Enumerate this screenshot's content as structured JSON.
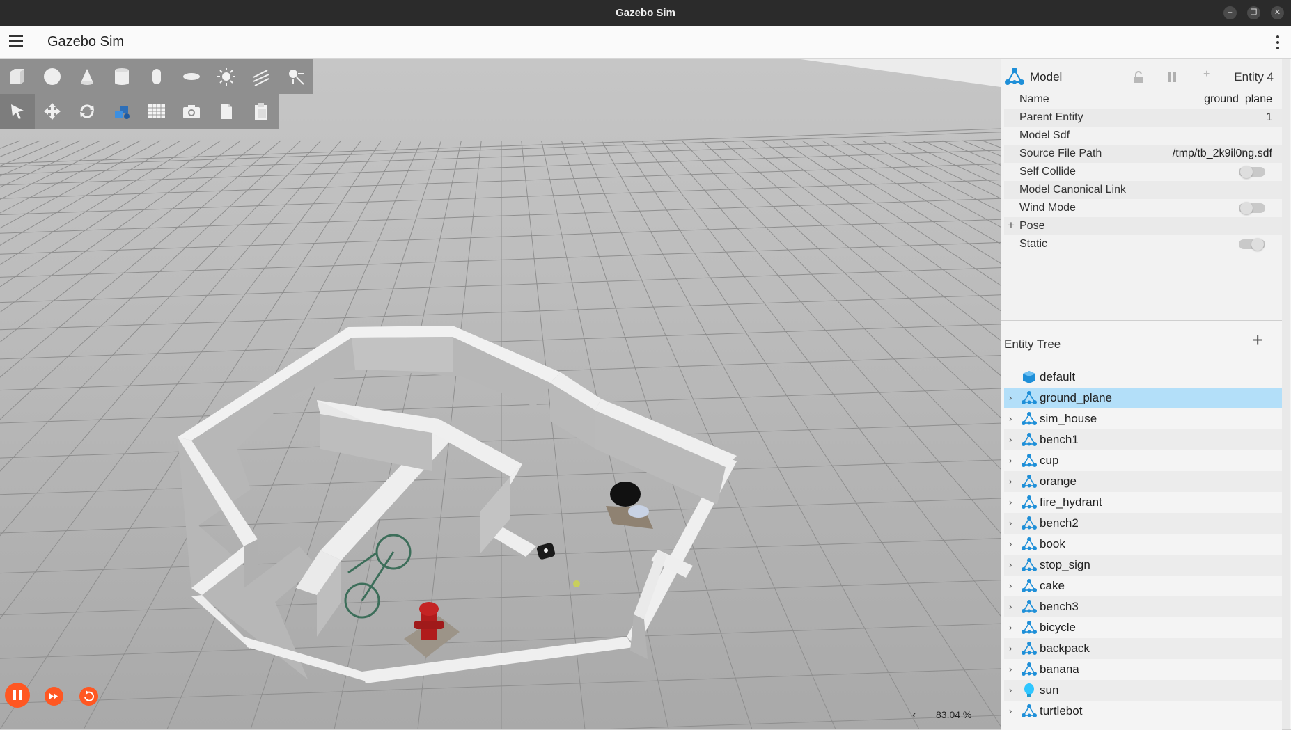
{
  "window": {
    "title": "Gazebo Sim",
    "minimize_icon": "minimize-icon",
    "restore_icon": "restore-icon",
    "close_icon": "close-icon"
  },
  "appbar": {
    "title": "Gazebo Sim",
    "menu_icon": "hamburger-menu-icon",
    "more_icon": "kebab-menu-icon"
  },
  "shapes_toolbar": [
    "box-icon",
    "sphere-icon",
    "cone-icon",
    "cylinder-icon",
    "capsule-icon",
    "ellipsoid-icon",
    "directional-light-icon",
    "spot-light-icon",
    "point-light-icon"
  ],
  "tools_toolbar": [
    "select-icon",
    "translate-icon",
    "rotate-icon",
    "transform-control-icon",
    "grid-config-icon",
    "screenshot-icon",
    "copy-icon",
    "paste-icon"
  ],
  "component_inspector": {
    "model_label": "Model",
    "entity_label": "Entity 4",
    "rows": [
      {
        "key": "Name",
        "value": "ground_plane",
        "type": "text"
      },
      {
        "key": "Parent Entity",
        "value": "1",
        "type": "text"
      },
      {
        "key": "Model Sdf",
        "value": "",
        "type": "text"
      },
      {
        "key": "Source File Path",
        "value": "/tmp/tb_2k9il0ng.sdf",
        "type": "text"
      },
      {
        "key": "Self Collide",
        "value": false,
        "type": "toggle"
      },
      {
        "key": "Model Canonical Link",
        "value": "",
        "type": "text"
      },
      {
        "key": "Wind Mode",
        "value": false,
        "type": "toggle"
      },
      {
        "key": "Pose",
        "value": "",
        "type": "expandable",
        "expand_label": "+"
      },
      {
        "key": "Static",
        "value": true,
        "type": "toggle"
      }
    ]
  },
  "entity_tree": {
    "title": "Entity Tree",
    "add_label": "+",
    "items": [
      {
        "label": "default",
        "icon": "world-icon",
        "expandable": false,
        "selected": false
      },
      {
        "label": "ground_plane",
        "icon": "model-icon",
        "expandable": true,
        "selected": true
      },
      {
        "label": "sim_house",
        "icon": "model-icon",
        "expandable": true,
        "selected": false
      },
      {
        "label": "bench1",
        "icon": "model-icon",
        "expandable": true,
        "selected": false
      },
      {
        "label": "cup",
        "icon": "model-icon",
        "expandable": true,
        "selected": false
      },
      {
        "label": "orange",
        "icon": "model-icon",
        "expandable": true,
        "selected": false
      },
      {
        "label": "fire_hydrant",
        "icon": "model-icon",
        "expandable": true,
        "selected": false
      },
      {
        "label": "bench2",
        "icon": "model-icon",
        "expandable": true,
        "selected": false
      },
      {
        "label": "book",
        "icon": "model-icon",
        "expandable": true,
        "selected": false
      },
      {
        "label": "stop_sign",
        "icon": "model-icon",
        "expandable": true,
        "selected": false
      },
      {
        "label": "cake",
        "icon": "model-icon",
        "expandable": true,
        "selected": false
      },
      {
        "label": "bench3",
        "icon": "model-icon",
        "expandable": true,
        "selected": false
      },
      {
        "label": "bicycle",
        "icon": "model-icon",
        "expandable": true,
        "selected": false
      },
      {
        "label": "backpack",
        "icon": "model-icon",
        "expandable": true,
        "selected": false
      },
      {
        "label": "banana",
        "icon": "model-icon",
        "expandable": true,
        "selected": false
      },
      {
        "label": "sun",
        "icon": "light-icon",
        "expandable": true,
        "selected": false
      },
      {
        "label": "turtlebot",
        "icon": "model-icon",
        "expandable": true,
        "selected": false
      }
    ]
  },
  "playback": {
    "play_pause_icon": "pause-icon",
    "step_icon": "fast-forward-icon",
    "reset_icon": "reset-icon"
  },
  "status": {
    "zoom": "83.04 %",
    "collapse_chevron": "‹"
  },
  "colors": {
    "accent": "#ff5722",
    "selected_row": "#b3dff9",
    "model_icon": "#1e8fd8",
    "toolbar_bg": "#8f8f8f"
  }
}
